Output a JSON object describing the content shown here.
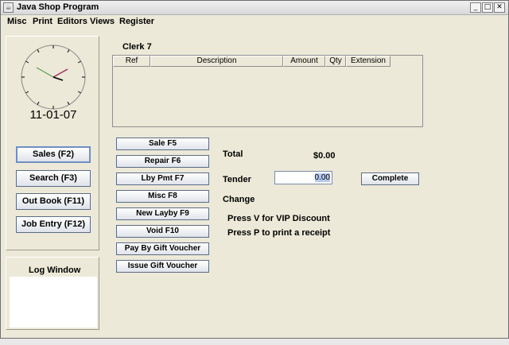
{
  "window": {
    "title": "Java Shop Program",
    "controls": {
      "minimize": "_",
      "maximize": "□",
      "close": "✕"
    }
  },
  "menu": [
    "Misc",
    "Print",
    "Editors",
    "Views",
    "Register"
  ],
  "left_panel": {
    "date": "11-01-07",
    "buttons": [
      "Sales (F2)",
      "Search (F3)",
      "Out Book (F11)",
      "Job Entry (F12)"
    ]
  },
  "log": {
    "label": "Log Window"
  },
  "clerk": "Clerk 7",
  "table": {
    "columns": [
      "Ref",
      "Description",
      "Amount",
      "Qty",
      "Extension"
    ]
  },
  "actions": [
    "Sale F5",
    "Repair F6",
    "Lby Pmt F7",
    "Misc F8",
    "New Layby F9",
    "Void F10",
    "Pay By Gift Voucher",
    "Issue Gift Voucher"
  ],
  "totals": {
    "total_label": "Total",
    "total_value": "$0.00",
    "tender_label": "Tender",
    "tender_value": "0.00",
    "change_label": "Change",
    "complete": "Complete"
  },
  "hints": [
    "Press V for VIP Discount",
    "Press P to print a receipt"
  ],
  "colors": {
    "second_hand": "#2e8b2e",
    "minute_hand": "#a0305a",
    "focus": "#6f8fc4"
  }
}
